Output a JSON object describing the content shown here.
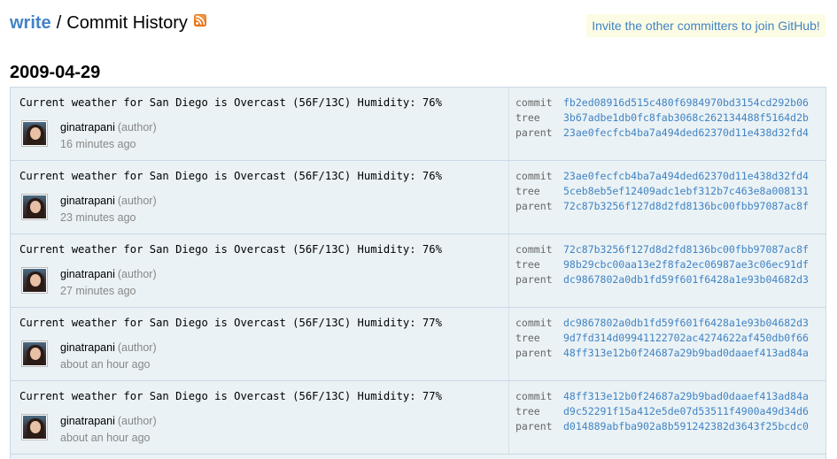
{
  "header": {
    "repo": "write",
    "separator": "/",
    "page_title": "Commit History",
    "rss_icon": "rss-feed-icon",
    "invite_text": "Invite the other committers to join GitHub!"
  },
  "date_heading": "2009-04-29",
  "labels": {
    "commit": "commit",
    "tree": "tree",
    "parent": "parent",
    "author_role": "(author)"
  },
  "colors": {
    "link": "#4183c4",
    "commit_bg": "#eaf2f5",
    "border": "#c9d9e6",
    "invite_bg": "#fcfce4"
  },
  "commits": [
    {
      "message": "Current weather for San Diego is Overcast (56F/13C) Humidity: 76%",
      "author": "ginatrapani",
      "time": "16 minutes ago",
      "commit": "fb2ed08916d515c480f6984970bd3154cd292b06",
      "tree": "3b67adbe1db0fc8fab3068c262134488f5164d2b",
      "parent": "23ae0fecfcb4ba7a494ded62370d11e438d32fd4"
    },
    {
      "message": "Current weather for San Diego is Overcast (56F/13C) Humidity: 76%",
      "author": "ginatrapani",
      "time": "23 minutes ago",
      "commit": "23ae0fecfcb4ba7a494ded62370d11e438d32fd4",
      "tree": "5ceb8eb5ef12409adc1ebf312b7c463e8a008131",
      "parent": "72c87b3256f127d8d2fd8136bc00fbb97087ac8f"
    },
    {
      "message": "Current weather for San Diego is Overcast (56F/13C) Humidity: 76%",
      "author": "ginatrapani",
      "time": "27 minutes ago",
      "commit": "72c87b3256f127d8d2fd8136bc00fbb97087ac8f",
      "tree": "98b29cbc00aa13e2f8fa2ec06987ae3c06ec91df",
      "parent": "dc9867802a0db1fd59f601f6428a1e93b04682d3"
    },
    {
      "message": "Current weather for San Diego is Overcast (56F/13C) Humidity: 77%",
      "author": "ginatrapani",
      "time": "about an hour ago",
      "commit": "dc9867802a0db1fd59f601f6428a1e93b04682d3",
      "tree": "9d7fd314d09941122702ac4274622af450db0f66",
      "parent": "48ff313e12b0f24687a29b9bad0daaef413ad84a"
    },
    {
      "message": "Current weather for San Diego is Overcast (56F/13C) Humidity: 77%",
      "author": "ginatrapani",
      "time": "about an hour ago",
      "commit": "48ff313e12b0f24687a29b9bad0daaef413ad84a",
      "tree": "d9c52291f15a412e5de07d53511f4900a49d34d6",
      "parent": "d014889abfba902a8b591242382d3643f25bcdc0"
    }
  ]
}
